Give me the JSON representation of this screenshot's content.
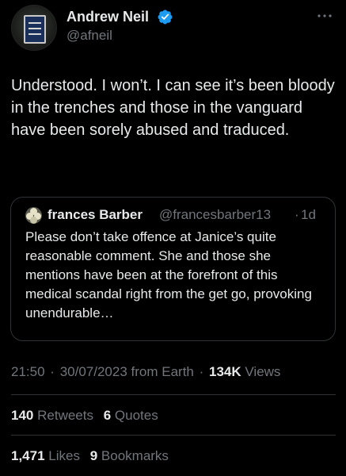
{
  "author": {
    "display_name": "Andrew Neil",
    "handle": "@afneil",
    "verified_icon": "verified-badge-icon",
    "avatar_icon": "sign-avatar"
  },
  "tweet": {
    "text": "Understood. I won’t. I can see it’s been bloody in the trenches and those in the vanguard have been sorely abused and traduced."
  },
  "quote": {
    "display_name": "frances Barber",
    "handle": "@francesbarber13",
    "separator": "·",
    "time": "1d",
    "text": "Please don’t take offence at Janice’s quite reasonable comment. She and those she mentions have been at the forefront of this medical scandal right from the get go, provoking unendurable…"
  },
  "meta": {
    "time": "21:50",
    "separator": "·",
    "date": "30/07/2023",
    "source": "from Earth",
    "views_count": "134K",
    "views_label": "Views"
  },
  "stats": {
    "retweets_count": "140",
    "retweets_label": "Retweets",
    "quotes_count": "6",
    "quotes_label": "Quotes",
    "likes_count": "1,471",
    "likes_label": "Likes",
    "bookmarks_count": "9",
    "bookmarks_label": "Bookmarks"
  },
  "colors": {
    "background": "#000000",
    "text_primary": "#e7e9ea",
    "text_secondary": "#71767b",
    "verified_blue": "#1d9bf0",
    "border": "#2f3336"
  }
}
